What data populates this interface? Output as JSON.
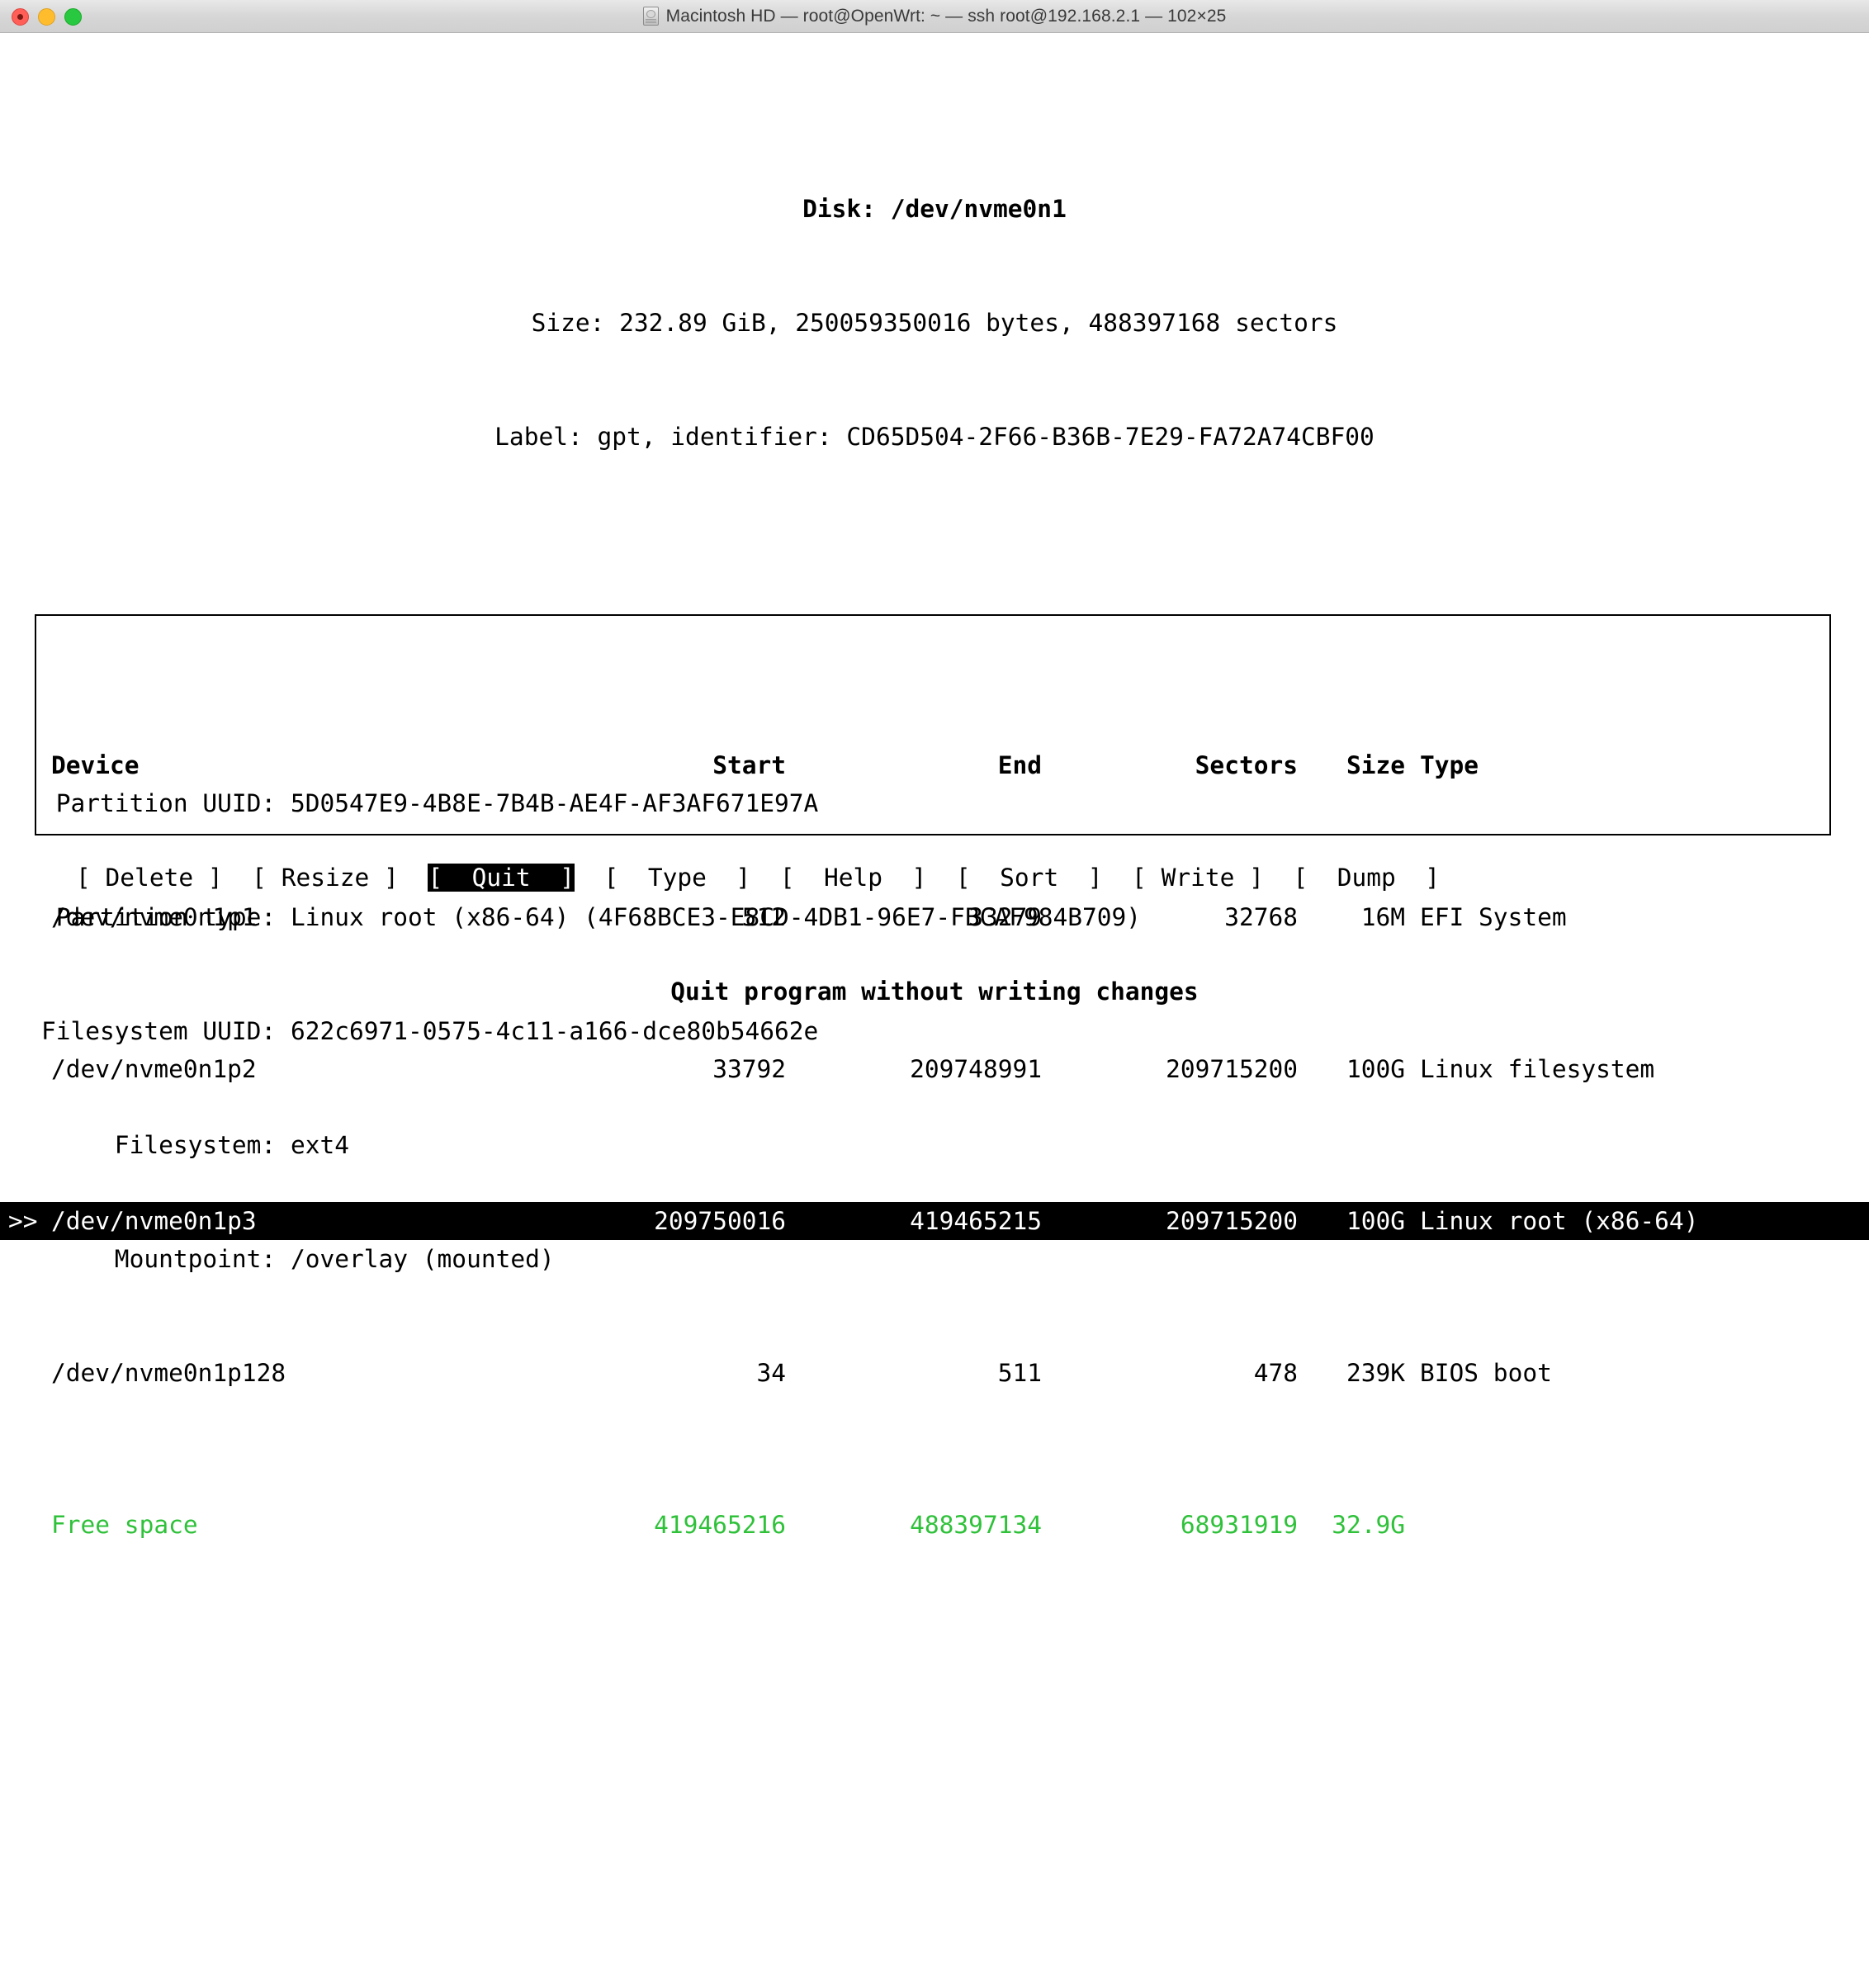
{
  "window": {
    "title": "Macintosh HD — root@OpenWrt: ~ — ssh root@192.168.2.1 — 102×25",
    "icon": "hard-disk-icon",
    "traffic_lights": [
      "close",
      "minimize",
      "maximize"
    ]
  },
  "colors": {
    "background": "#ffffff",
    "foreground": "#000000",
    "free_space_green": "#2fc13a",
    "selection_bg": "#000000",
    "selection_fg": "#ffffff",
    "titlebar_bg": "#d6d6d6"
  },
  "header": {
    "disk_line": "Disk: /dev/nvme0n1",
    "size_line": "Size: 232.89 GiB, 250059350016 bytes, 488397168 sectors",
    "label_line": "Label: gpt, identifier: CD65D504-2F66-B36B-7E29-FA72A74CBF00"
  },
  "table": {
    "columns": [
      "Device",
      "Start",
      "End",
      "Sectors",
      "Size",
      "Type"
    ],
    "rows": [
      {
        "marker": "",
        "device": "/dev/nvme0n1p1",
        "start": "512",
        "end": "33279",
        "sectors": "32768",
        "size": "16M",
        "type": "EFI System",
        "selected": false,
        "free": false
      },
      {
        "marker": "",
        "device": "/dev/nvme0n1p2",
        "start": "33792",
        "end": "209748991",
        "sectors": "209715200",
        "size": "100G",
        "type": "Linux filesystem",
        "selected": false,
        "free": false
      },
      {
        "marker": ">>",
        "device": "/dev/nvme0n1p3",
        "start": "209750016",
        "end": "419465215",
        "sectors": "209715200",
        "size": "100G",
        "type": "Linux root (x86-64)",
        "selected": true,
        "free": false
      },
      {
        "marker": "",
        "device": "/dev/nvme0n1p128",
        "start": "34",
        "end": "511",
        "sectors": "478",
        "size": "239K",
        "type": "BIOS boot",
        "selected": false,
        "free": false
      },
      {
        "marker": "",
        "device": "Free space",
        "start": "419465216",
        "end": "488397134",
        "sectors": "68931919",
        "size": "32.9G",
        "type": "",
        "selected": false,
        "free": true
      }
    ]
  },
  "details": {
    "lines": [
      {
        "label": " Partition UUID:",
        "value": "5D0547E9-4B8E-7B4B-AE4F-AF3AF671E97A"
      },
      {
        "label": " Partition type:",
        "value": "Linux root (x86-64) (4F68BCE3-E8CD-4DB1-96E7-FBCAF984B709)"
      },
      {
        "label": "Filesystem UUID:",
        "value": "622c6971-0575-4c11-a166-dce80b54662e"
      },
      {
        "label": "     Filesystem:",
        "value": "ext4"
      },
      {
        "label": "     Mountpoint:",
        "value": "/overlay (mounted)"
      }
    ]
  },
  "menu": {
    "items": [
      {
        "label": "Delete",
        "selected": false
      },
      {
        "label": "Resize",
        "selected": false
      },
      {
        "label": "Quit",
        "selected": true
      },
      {
        "label": "Type",
        "selected": false
      },
      {
        "label": "Help",
        "selected": false
      },
      {
        "label": "Sort",
        "selected": false
      },
      {
        "label": "Write",
        "selected": false
      },
      {
        "label": "Dump",
        "selected": false
      }
    ]
  },
  "status": {
    "hint": "Quit program without writing changes"
  }
}
